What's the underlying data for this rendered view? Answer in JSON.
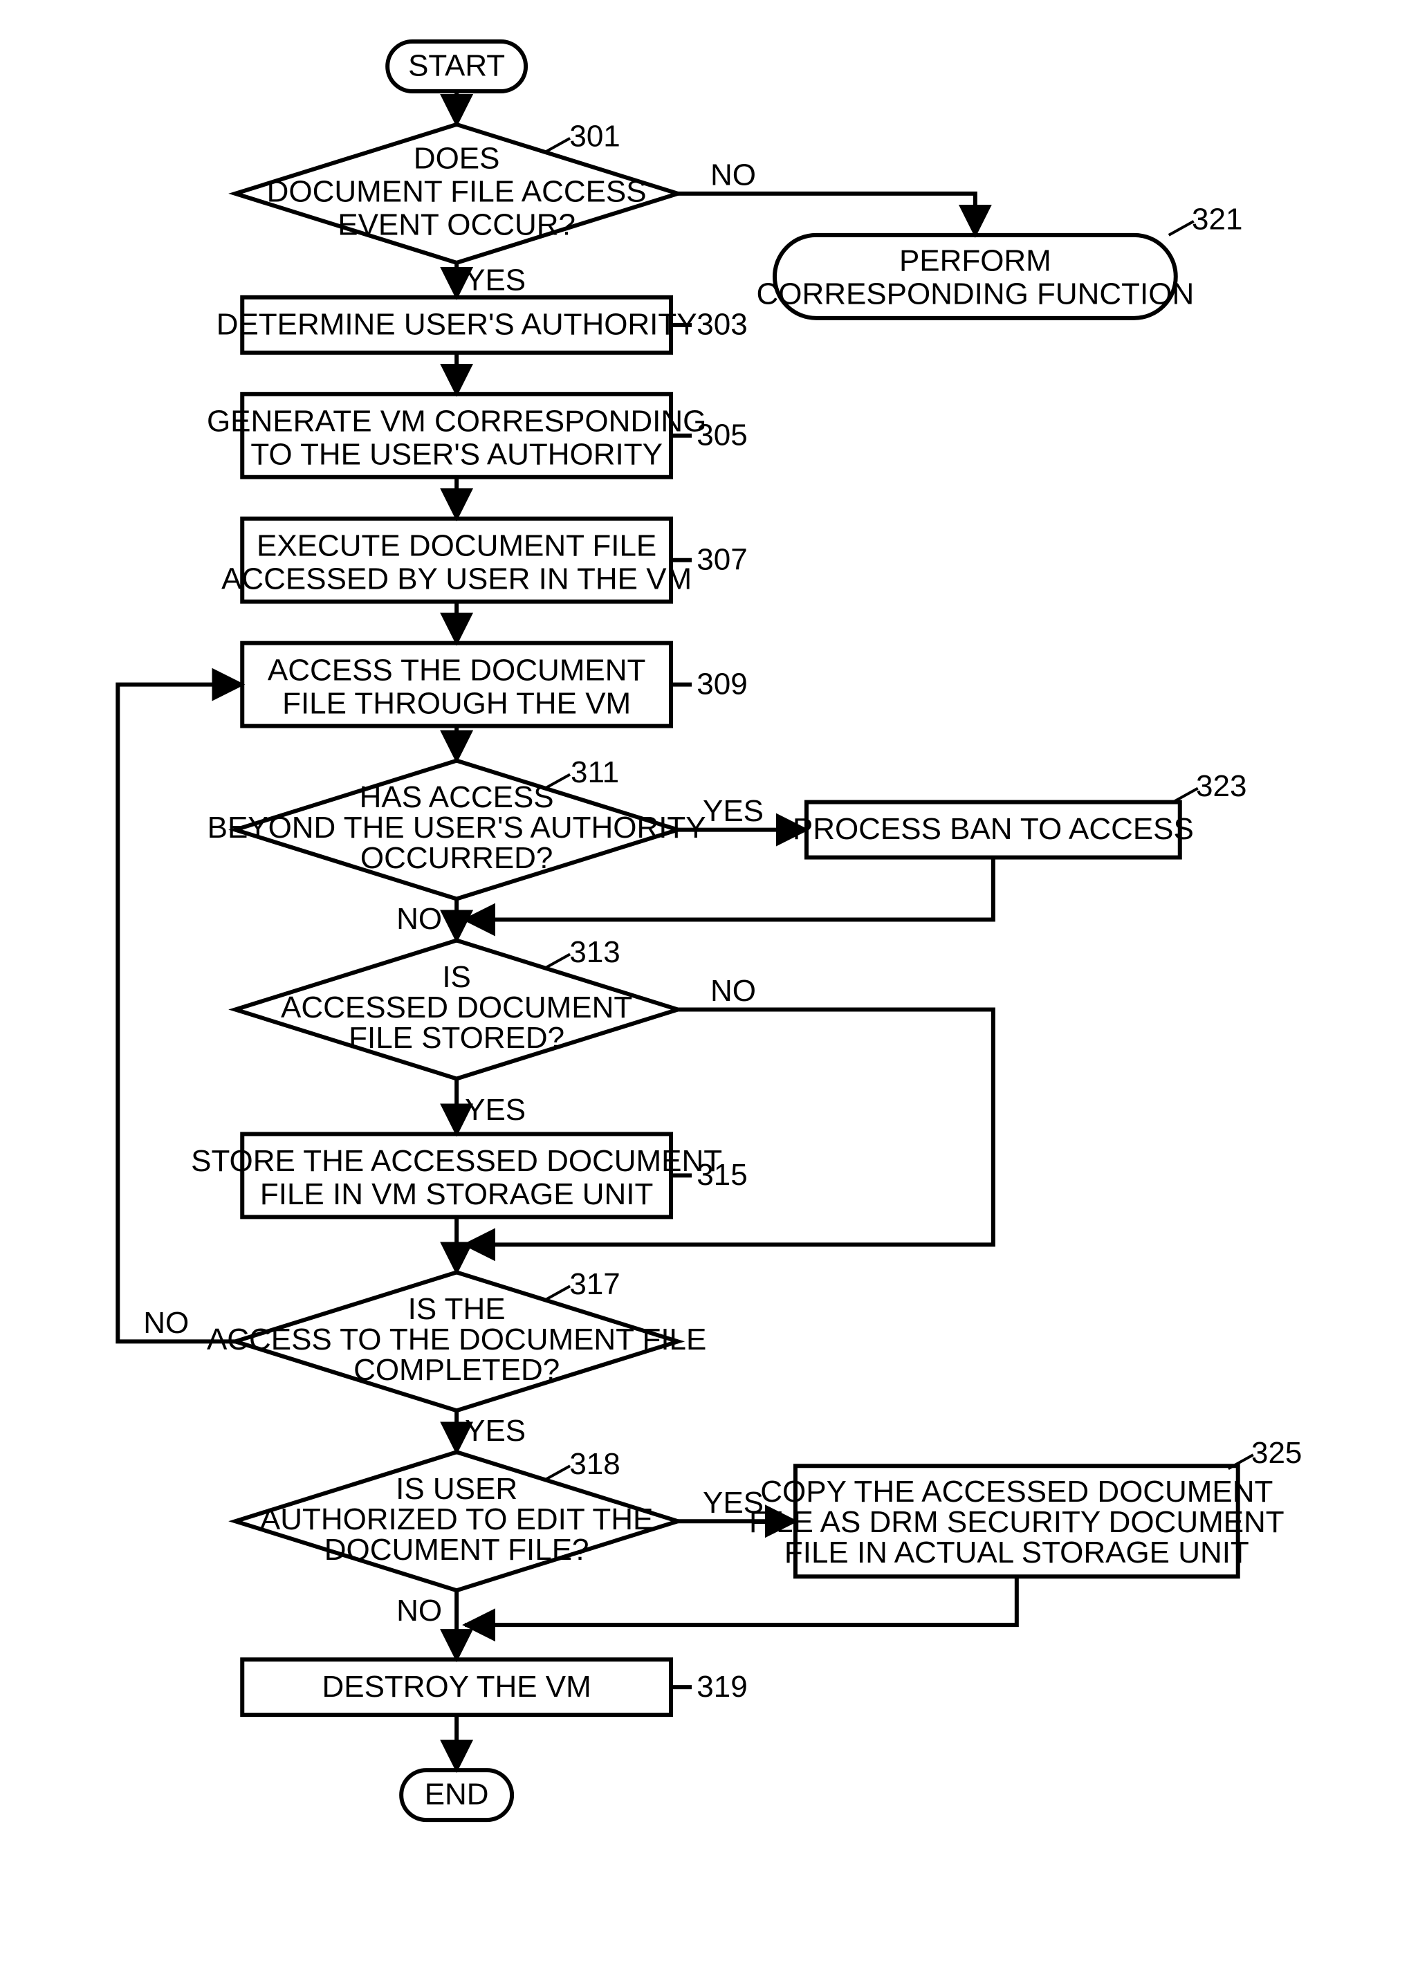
{
  "chart_data": {
    "type": "flowchart",
    "nodes": [
      {
        "id": "start",
        "type": "terminator",
        "label": "START"
      },
      {
        "id": "301",
        "type": "decision",
        "label": [
          "DOES",
          "DOCUMENT FILE ACCESS",
          "EVENT OCCUR?"
        ],
        "ref": "301"
      },
      {
        "id": "321",
        "type": "terminator",
        "label": [
          "PERFORM",
          "CORRESPONDING FUNCTION"
        ],
        "ref": "321"
      },
      {
        "id": "303",
        "type": "process",
        "label": [
          "DETERMINE USER'S AUTHORITY"
        ],
        "ref": "303"
      },
      {
        "id": "305",
        "type": "process",
        "label": [
          "GENERATE VM CORRESPONDING",
          "TO THE USER'S AUTHORITY"
        ],
        "ref": "305"
      },
      {
        "id": "307",
        "type": "process",
        "label": [
          "EXECUTE DOCUMENT FILE",
          "ACCESSED BY USER IN THE VM"
        ],
        "ref": "307"
      },
      {
        "id": "309",
        "type": "process",
        "label": [
          "ACCESS THE DOCUMENT",
          "FILE THROUGH THE VM"
        ],
        "ref": "309"
      },
      {
        "id": "311",
        "type": "decision",
        "label": [
          "HAS ACCESS",
          "BEYOND THE USER'S AUTHORITY",
          "OCCURRED?"
        ],
        "ref": "311"
      },
      {
        "id": "323",
        "type": "process",
        "label": [
          "PROCESS BAN TO ACCESS"
        ],
        "ref": "323"
      },
      {
        "id": "313",
        "type": "decision",
        "label": [
          "IS",
          "ACCESSED DOCUMENT",
          "FILE STORED?"
        ],
        "ref": "313"
      },
      {
        "id": "315",
        "type": "process",
        "label": [
          "STORE THE ACCESSED DOCUMENT",
          "FILE IN VM STORAGE UNIT"
        ],
        "ref": "315"
      },
      {
        "id": "317",
        "type": "decision",
        "label": [
          "IS THE",
          "ACCESS TO THE DOCUMENT FILE",
          "COMPLETED?"
        ],
        "ref": "317"
      },
      {
        "id": "318",
        "type": "decision",
        "label": [
          "IS USER",
          "AUTHORIZED TO EDIT THE",
          "DOCUMENT FILE?"
        ],
        "ref": "318"
      },
      {
        "id": "325",
        "type": "process",
        "label": [
          "COPY THE ACCESSED DOCUMENT",
          "FILE AS DRM SECURITY DOCUMENT",
          "FILE IN ACTUAL STORAGE UNIT"
        ],
        "ref": "325"
      },
      {
        "id": "319",
        "type": "process",
        "label": [
          "DESTROY THE VM"
        ],
        "ref": "319"
      },
      {
        "id": "end",
        "type": "terminator",
        "label": "END"
      }
    ],
    "edges": [
      {
        "from": "start",
        "to": "301"
      },
      {
        "from": "301",
        "to": "321",
        "label": "NO"
      },
      {
        "from": "301",
        "to": "303",
        "label": "YES"
      },
      {
        "from": "303",
        "to": "305"
      },
      {
        "from": "305",
        "to": "307"
      },
      {
        "from": "307",
        "to": "309"
      },
      {
        "from": "309",
        "to": "311"
      },
      {
        "from": "311",
        "to": "323",
        "label": "YES"
      },
      {
        "from": "311",
        "to": "313",
        "label": "NO"
      },
      {
        "from": "323",
        "to": "313_input"
      },
      {
        "from": "313",
        "to": "315",
        "label": "YES"
      },
      {
        "from": "313",
        "to": "317_input",
        "label": "NO"
      },
      {
        "from": "315",
        "to": "317"
      },
      {
        "from": "317",
        "to": "309_input",
        "label": "NO"
      },
      {
        "from": "317",
        "to": "318",
        "label": "YES"
      },
      {
        "from": "318",
        "to": "325",
        "label": "YES"
      },
      {
        "from": "318",
        "to": "319",
        "label": "NO"
      },
      {
        "from": "325",
        "to": "319_input"
      },
      {
        "from": "319",
        "to": "end"
      }
    ]
  },
  "labels": {
    "start": "START",
    "end": "END",
    "n301_l1": "DOES",
    "n301_l2": "DOCUMENT FILE ACCESS",
    "n301_l3": "EVENT OCCUR?",
    "r301": "301",
    "n321_l1": "PERFORM",
    "n321_l2": "CORRESPONDING FUNCTION",
    "r321": "321",
    "n303_l1": "DETERMINE USER'S AUTHORITY",
    "r303": "303",
    "n305_l1": "GENERATE VM CORRESPONDING",
    "n305_l2": "TO THE USER'S AUTHORITY",
    "r305": "305",
    "n307_l1": "EXECUTE DOCUMENT FILE",
    "n307_l2": "ACCESSED BY USER IN THE VM",
    "r307": "307",
    "n309_l1": "ACCESS THE DOCUMENT",
    "n309_l2": "FILE THROUGH THE VM",
    "r309": "309",
    "n311_l1": "HAS ACCESS",
    "n311_l2": "BEYOND THE USER'S AUTHORITY",
    "n311_l3": "OCCURRED?",
    "r311": "311",
    "n323_l1": "PROCESS BAN TO ACCESS",
    "r323": "323",
    "n313_l1": "IS",
    "n313_l2": "ACCESSED DOCUMENT",
    "n313_l3": "FILE STORED?",
    "r313": "313",
    "n315_l1": "STORE THE ACCESSED DOCUMENT",
    "n315_l2": "FILE IN VM STORAGE UNIT",
    "r315": "315",
    "n317_l1": "IS THE",
    "n317_l2": "ACCESS TO THE DOCUMENT FILE",
    "n317_l3": "COMPLETED?",
    "r317": "317",
    "n318_l1": "IS USER",
    "n318_l2": "AUTHORIZED TO EDIT THE",
    "n318_l3": "DOCUMENT FILE?",
    "r318": "318",
    "n325_l1": "COPY THE ACCESSED DOCUMENT",
    "n325_l2": "FILE AS DRM SECURITY DOCUMENT",
    "n325_l3": "FILE IN ACTUAL STORAGE UNIT",
    "r325": "325",
    "n319_l1": "DESTROY THE VM",
    "r319": "319",
    "YES": "YES",
    "NO": "NO"
  }
}
